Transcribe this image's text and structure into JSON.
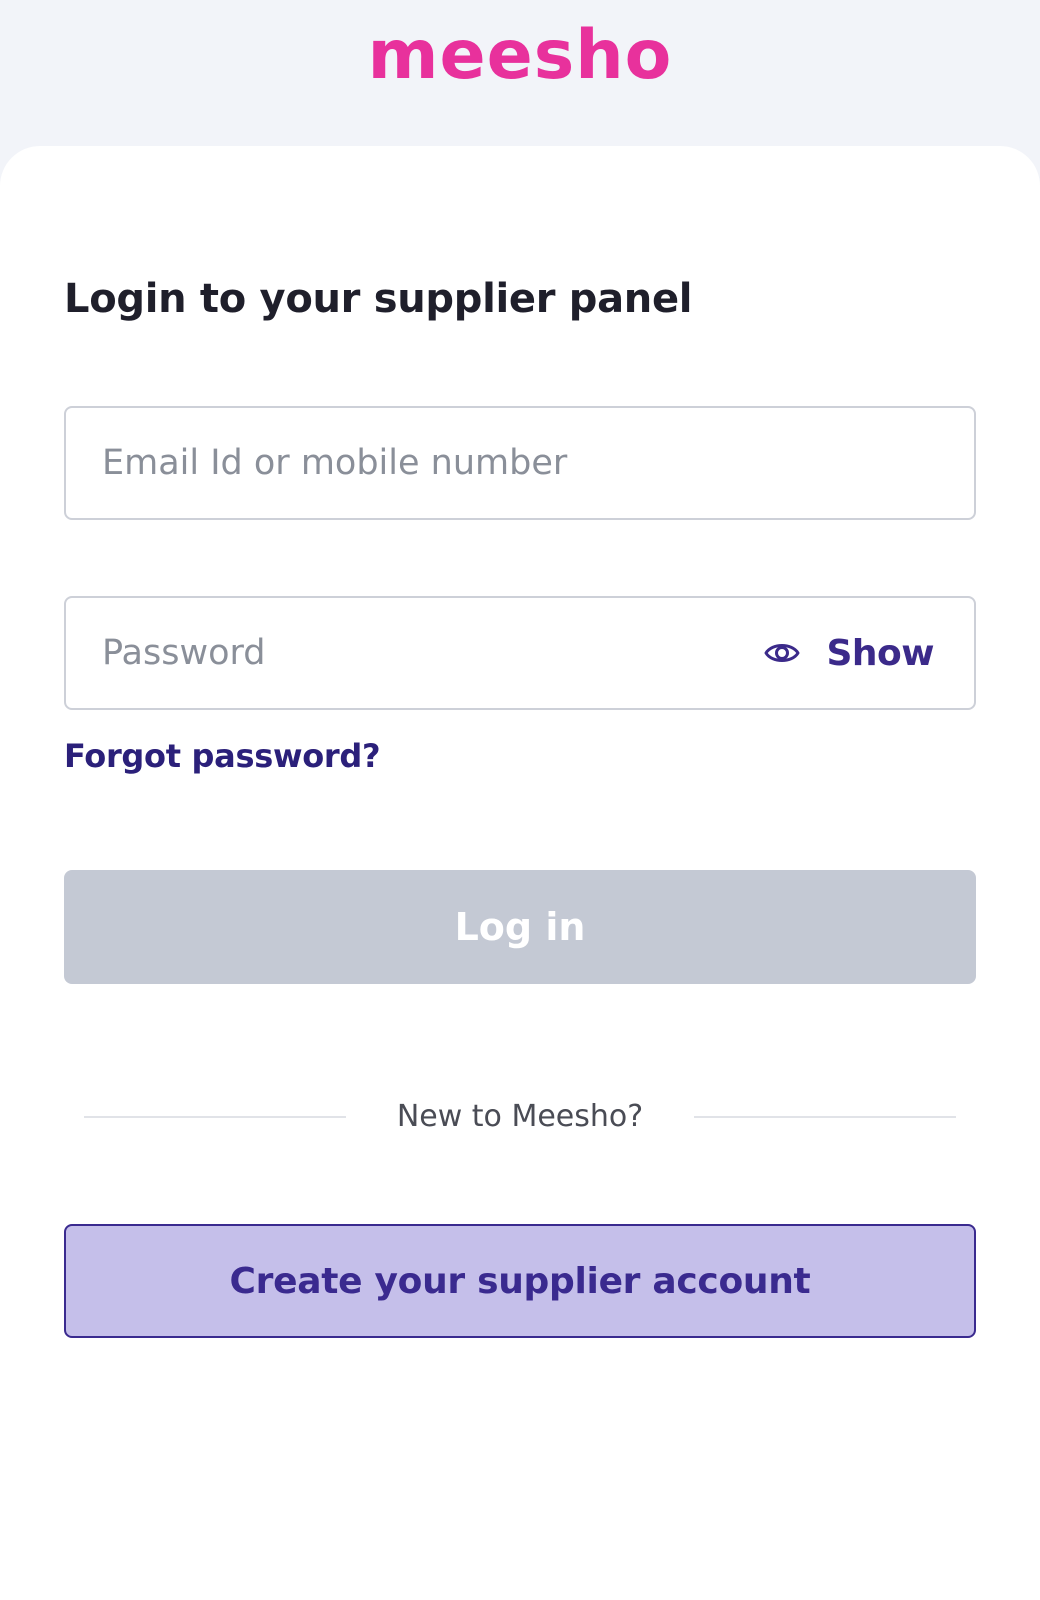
{
  "brand": {
    "logo_text": "meesho",
    "logo_color": "#e8319c"
  },
  "login": {
    "title": "Login to your supplier panel",
    "email_placeholder": "Email Id or mobile number",
    "email_value": "",
    "password_placeholder": "Password",
    "password_value": "",
    "show_label": "Show",
    "show_icon": "eye-icon",
    "forgot_label": "Forgot password?",
    "login_label": "Log in",
    "login_button_state": "disabled"
  },
  "signup": {
    "divider_text": "New to Meesho?",
    "create_label": "Create your supplier account"
  },
  "colors": {
    "accent": "#3a2a8f",
    "disabled_button": "#c4c9d4",
    "secondary_button_bg": "#c5bfea",
    "page_bg": "#f2f4f9"
  }
}
